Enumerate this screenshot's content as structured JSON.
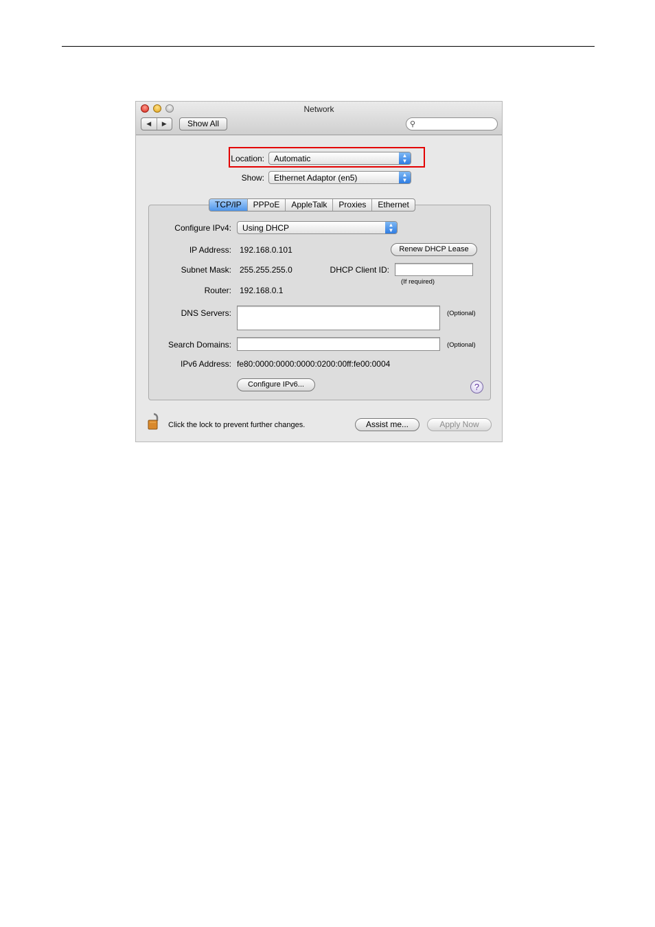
{
  "window": {
    "title": "Network"
  },
  "toolbar": {
    "back_glyph": "◀",
    "forward_glyph": "▶",
    "show_all": "Show All",
    "search_placeholder": "",
    "search_icon": "magnifier-icon"
  },
  "location": {
    "label": "Location:",
    "value": "Automatic"
  },
  "show": {
    "label": "Show:",
    "value": "Ethernet Adaptor (en5)"
  },
  "tabs": [
    "TCP/IP",
    "PPPoE",
    "AppleTalk",
    "Proxies",
    "Ethernet"
  ],
  "active_tab": "TCP/IP",
  "tcpip": {
    "configure_label": "Configure IPv4:",
    "configure_value": "Using DHCP",
    "ip_label": "IP Address:",
    "ip_value": "192.168.0.101",
    "renew_button": "Renew DHCP Lease",
    "subnet_label": "Subnet Mask:",
    "subnet_value": "255.255.255.0",
    "dhcp_client_label": "DHCP Client ID:",
    "dhcp_client_value": "",
    "if_required": "(If required)",
    "router_label": "Router:",
    "router_value": "192.168.0.1",
    "dns_label": "DNS Servers:",
    "dns_value": "",
    "dns_optional": "(Optional)",
    "search_label": "Search Domains:",
    "search_value": "",
    "search_optional": "(Optional)",
    "ipv6_label": "IPv6 Address:",
    "ipv6_value": "fe80:0000:0000:0000:0200:00ff:fe00:0004",
    "configure_ipv6_button": "Configure IPv6...",
    "help_glyph": "?"
  },
  "footer": {
    "lock_text": "Click the lock to prevent further changes.",
    "assist_button": "Assist me...",
    "apply_button": "Apply Now"
  },
  "colors": {
    "highlight": "#e30000",
    "active_tab": "#4f95ea"
  }
}
